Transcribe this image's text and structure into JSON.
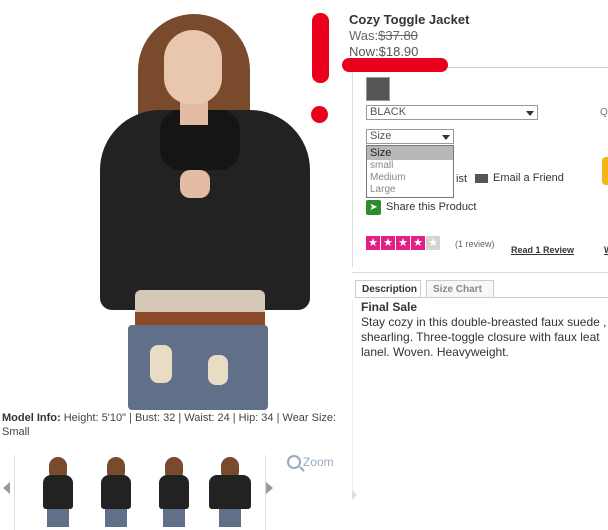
{
  "product": {
    "title": "Cozy Toggle Jacket",
    "was_label": "Was:",
    "was_price": "$37.80",
    "now_label": "Now:",
    "now_price": "$18.90"
  },
  "model_info": {
    "label": "Model Info:",
    "text": " Height: 5'10\" | Bust: 32 | Waist: 24 | Hip: 34 | Wear Size: Small"
  },
  "zoom": {
    "label": "Zoom"
  },
  "color_select": {
    "value": "BLACK"
  },
  "q_text": "Q",
  "size_select": {
    "value": "Size",
    "options": [
      "Size",
      "small",
      "Medium",
      "Large"
    ]
  },
  "wishlist_fragment": "ist",
  "email": {
    "label": "Email a Friend"
  },
  "share": {
    "label": "Share this Product"
  },
  "rating": {
    "stars": 4,
    "max": 5,
    "count_text": "(1 review)",
    "read_label": "Read 1 Review",
    "extra_link": "W"
  },
  "tabs": [
    "Description",
    "Size Chart"
  ],
  "description": {
    "heading": "Final Sale",
    "lines": [
      "Stay cozy in this double-breasted faux suede ,",
      "shearling. Three-toggle closure with faux leat",
      "lanel. Woven. Heavyweight."
    ]
  },
  "colors": {
    "annotation": "#e8001c",
    "star": "#e51f8a",
    "share": "#2e8b2e",
    "button": "#f5b614"
  }
}
